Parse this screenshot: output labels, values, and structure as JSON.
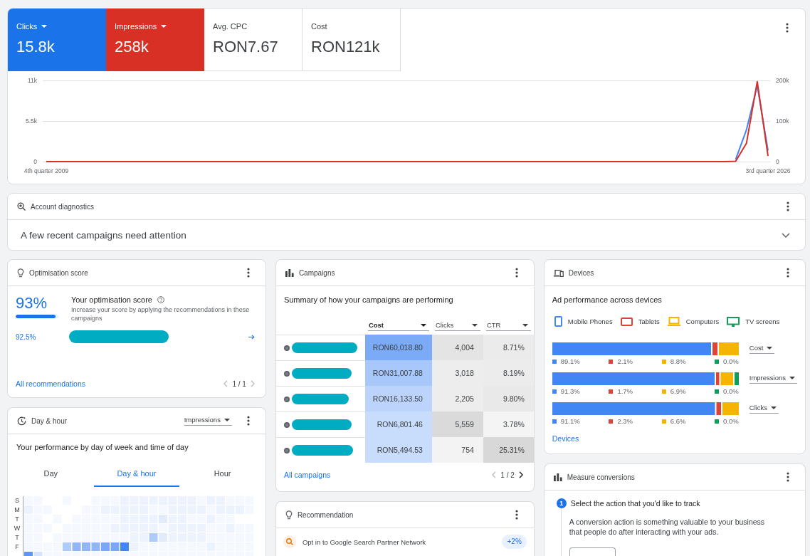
{
  "overview": {
    "metrics": [
      {
        "label": "Clicks",
        "value": "15.8k",
        "selected": true,
        "color": "#1a73e8"
      },
      {
        "label": "Impressions",
        "value": "258k",
        "selected": true,
        "color": "#d93025"
      },
      {
        "label": "Avg. CPC",
        "value": "RON7.67",
        "selected": false
      },
      {
        "label": "Cost",
        "value": "RON121k",
        "selected": false
      }
    ],
    "chart_data": {
      "type": "line",
      "categories": [
        "4th quarter 2009",
        null,
        null,
        null,
        null,
        null,
        null,
        null,
        null,
        null,
        null,
        null,
        null,
        null,
        null,
        null,
        null,
        null,
        null,
        null,
        null,
        null,
        null,
        null,
        null,
        null,
        null,
        null,
        null,
        null,
        null,
        null,
        null,
        null,
        null,
        null,
        null,
        null,
        null,
        null,
        null,
        null,
        null,
        null,
        null,
        null,
        null,
        null,
        null,
        null,
        null,
        null,
        null,
        null,
        null,
        null,
        null,
        null,
        null,
        null,
        null,
        null,
        null,
        null,
        null,
        null,
        null,
        "3rd quarter 2026"
      ],
      "ylim": [
        0,
        11000
      ],
      "yticks": [
        {
          "value": 0,
          "label": "0"
        },
        {
          "value": 5500,
          "label": "5.5k"
        },
        {
          "value": 11000,
          "label": "11k"
        }
      ],
      "y2lim": [
        0,
        200000
      ],
      "y2ticks": [
        {
          "value": 0,
          "label": "0"
        },
        {
          "value": 100000,
          "label": "100k"
        },
        {
          "value": 200000,
          "label": "200k"
        }
      ],
      "series": [
        {
          "color": "#4285f4",
          "values": [
            null,
            null,
            null,
            null,
            null,
            null,
            null,
            null,
            null,
            null,
            null,
            null,
            null,
            null,
            null,
            null,
            null,
            null,
            null,
            null,
            null,
            null,
            null,
            null,
            null,
            null,
            null,
            null,
            null,
            null,
            null,
            null,
            null,
            null,
            null,
            null,
            null,
            null,
            null,
            null,
            null,
            null,
            null,
            null,
            null,
            null,
            null,
            null,
            null,
            null,
            null,
            null,
            null,
            null,
            null,
            null,
            null,
            null,
            null,
            null,
            null,
            null,
            null,
            null,
            300,
            4300,
            10300,
            1500
          ]
        },
        {
          "color": "#d93025",
          "axis": "y2",
          "values": [
            0,
            0,
            0,
            0,
            0,
            0,
            0,
            0,
            0,
            0,
            0,
            0,
            0,
            0,
            0,
            0,
            0,
            0,
            0,
            0,
            0,
            0,
            0,
            0,
            0,
            0,
            0,
            0,
            0,
            0,
            0,
            0,
            0,
            0,
            0,
            0,
            0,
            0,
            0,
            0,
            0,
            0,
            0,
            0,
            0,
            0,
            0,
            0,
            0,
            0,
            0,
            0,
            0,
            0,
            0,
            0,
            0,
            0,
            0,
            0,
            0,
            0,
            0,
            0,
            1000,
            45000,
            197000,
            14000
          ]
        }
      ]
    }
  },
  "diagnostics": {
    "title": "Account diagnostics",
    "message": "A few recent campaigns need attention",
    "expanded": false
  },
  "optimisation": {
    "title": "Optimisation score",
    "score": "93%",
    "level": 0.93,
    "heading": "Your optimisation score",
    "description": "Increase your score by applying the recommendations in these campaigns",
    "items": [
      {
        "uplift": "92.5%",
        "name_redacted": true
      }
    ],
    "link": "All recommendations",
    "pager": {
      "label": "1 / 1",
      "prev_disabled": true,
      "next_disabled": true
    }
  },
  "day_hour": {
    "title": "Day & hour",
    "metric_dropdown": "Impressions",
    "subtitle": "Your performance by day of week and time of day",
    "tabs": [
      {
        "label": "Day",
        "selected": false
      },
      {
        "label": "Day & hour",
        "selected": true
      },
      {
        "label": "Hour",
        "selected": false
      }
    ],
    "day_labels": [
      "S",
      "M",
      "T",
      "W",
      "T",
      "F"
    ]
  },
  "campaigns": {
    "title": "Campaigns",
    "subtitle": "Summary of how your campaigns are performing",
    "columns": [
      {
        "label": "Cost",
        "sorted": true
      },
      {
        "label": "Clicks",
        "sorted": false
      },
      {
        "label": "CTR",
        "sorted": false
      }
    ],
    "rows": [
      {
        "paused": true,
        "name_redacted": true,
        "cells": [
          {
            "text": "RON60,018.80",
            "color": "#7baaf7"
          },
          {
            "text": "4,004",
            "color": "#e4e4e4"
          },
          {
            "text": "8.71%",
            "color": "#ebebeb"
          }
        ]
      },
      {
        "paused": true,
        "name_redacted": true,
        "cells": [
          {
            "text": "RON31,007.88",
            "color": "#a8c7fa"
          },
          {
            "text": "3,018",
            "color": "#ededed"
          },
          {
            "text": "8.19%",
            "color": "#ececec"
          }
        ]
      },
      {
        "paused": true,
        "name_redacted": true,
        "cells": [
          {
            "text": "RON16,133.50",
            "color": "#bcd4fb"
          },
          {
            "text": "2,205",
            "color": "#ededed"
          },
          {
            "text": "9.80%",
            "color": "#e9e9e9"
          }
        ]
      },
      {
        "paused": true,
        "name_redacted": true,
        "cells": [
          {
            "text": "RON6,801.46",
            "color": "#c8dcfb"
          },
          {
            "text": "5,559",
            "color": "#dadada"
          },
          {
            "text": "3.78%",
            "color": "#f4f4f4"
          }
        ]
      },
      {
        "paused": true,
        "name_redacted": true,
        "cells": [
          {
            "text": "RON5,494.53",
            "color": "#c8dcfb"
          },
          {
            "text": "754",
            "color": "#f3f3f3"
          },
          {
            "text": "25.31%",
            "color": "#d8d8d8"
          }
        ]
      }
    ],
    "link": "All campaigns",
    "pager": {
      "label": "1 / 2",
      "prev_disabled": true,
      "next_disabled": false
    }
  },
  "recommendation": {
    "title": "Recommendation",
    "items": [
      {
        "text": "Opt in to Google Search Partner Network",
        "badge": "+2%"
      }
    ]
  },
  "devices": {
    "title": "Devices",
    "subtitle": "Ad performance across devices",
    "legend": [
      {
        "label": "Mobile Phones",
        "kind": "phone",
        "color": "#4285f4"
      },
      {
        "label": "Tablets",
        "kind": "tablet",
        "color": "#db4437"
      },
      {
        "label": "Computers",
        "kind": "computer",
        "color": "#f4b400"
      },
      {
        "label": "TV screens",
        "kind": "tv",
        "color": "#0f9d58"
      }
    ],
    "bars": [
      {
        "metric": "Cost",
        "readings": [
          "89.1%",
          "2.1%",
          "8.8%",
          "0.0%"
        ]
      },
      {
        "metric": "Impressions",
        "readings": [
          "91.3%",
          "1.7%",
          "6.9%",
          "0.0%"
        ]
      },
      {
        "metric": "Clicks",
        "readings": [
          "91.1%",
          "2.3%",
          "6.6%",
          "0.0%"
        ]
      }
    ],
    "link": "Devices"
  },
  "conversions": {
    "title": "Measure conversions",
    "steps": [
      {
        "number": "1",
        "active": true,
        "title": "Select the action that you'd like to track",
        "description": "A conversion action is something valuable to your business that people do after interacting with your ads.",
        "has_button": true
      }
    ]
  }
}
